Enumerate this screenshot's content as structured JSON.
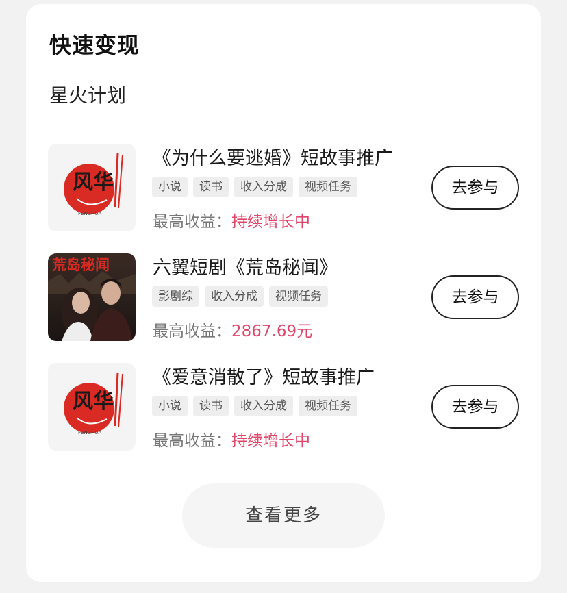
{
  "section": {
    "title": "快速变现",
    "subtitle": "星火计划"
  },
  "tasks": [
    {
      "title": "《为什么要逃婚》短故事推广",
      "tags": [
        "小说",
        "读书",
        "收入分成",
        "视频任务"
      ],
      "earn_label": "最高收益：",
      "earn_value": "持续增长中",
      "button": "去参与",
      "thumb": "fenghua-logo",
      "logo_text": "风华",
      "logo_sub": "FENGHUA"
    },
    {
      "title": "六翼短剧《荒岛秘闻》",
      "tags": [
        "影剧综",
        "收入分成",
        "视频任务"
      ],
      "earn_label": "最高收益：",
      "earn_value": "2867.69元",
      "button": "去参与",
      "thumb": "drama-poster",
      "poster_text": "荒岛秘闻"
    },
    {
      "title": "《爱意消散了》短故事推广",
      "tags": [
        "小说",
        "读书",
        "收入分成",
        "视频任务"
      ],
      "earn_label": "最高收益：",
      "earn_value": "持续增长中",
      "button": "去参与",
      "thumb": "fenghua-logo",
      "logo_text": "风华",
      "logo_sub": "FENGHUA"
    }
  ],
  "more_button": "查看更多",
  "colors": {
    "accent": "#e0476a",
    "logo_red": "#d92b23"
  }
}
